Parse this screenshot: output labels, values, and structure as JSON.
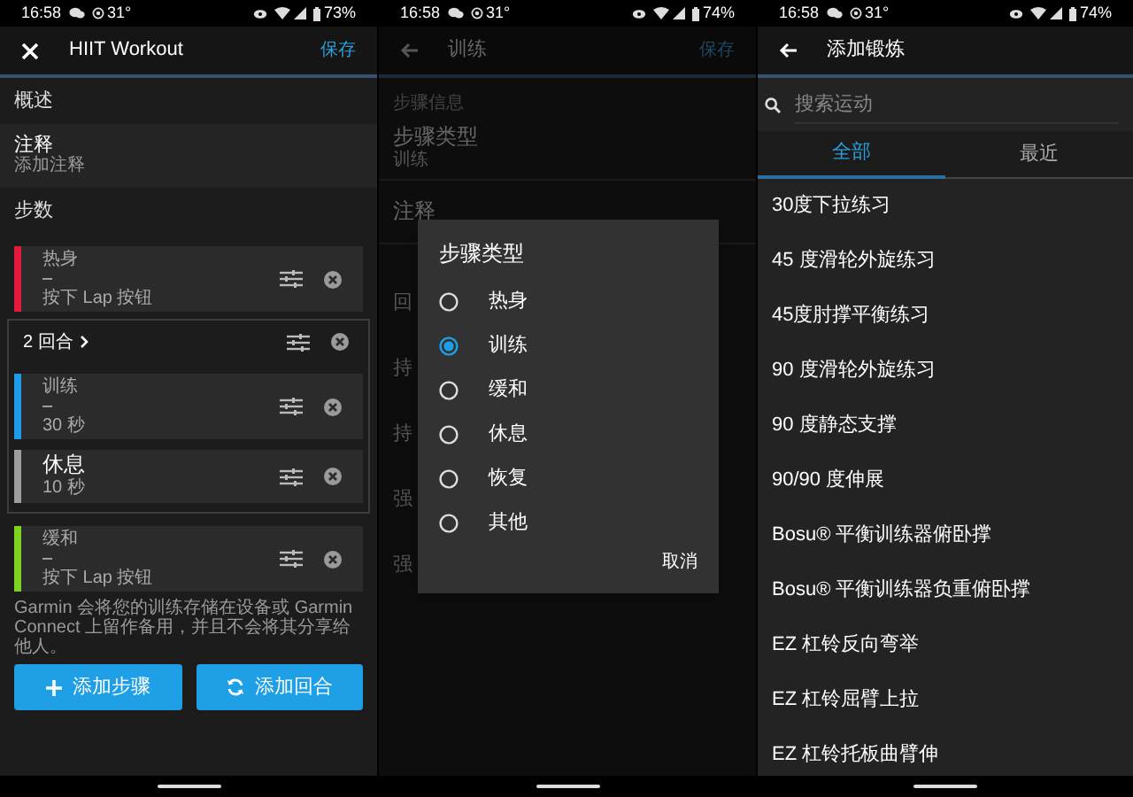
{
  "workout_screen": {
    "status_bar": {
      "time": "16:58",
      "temperature": "31°",
      "battery": "73%"
    },
    "title": "HIIT Workout",
    "save": "保存",
    "overview_header": "概述",
    "note": {
      "label": "注释",
      "placeholder": "添加注释"
    },
    "steps_header": "步数",
    "steps": [
      {
        "kind": "step",
        "color": "#e3183d",
        "title": "热身",
        "target": "–",
        "duration": "按下 Lap 按钮"
      },
      {
        "kind": "repeat",
        "label": "2 回合",
        "children": [
          {
            "kind": "step",
            "color": "#1e9be9",
            "title": "训练",
            "target": "–",
            "duration": "30 秒"
          },
          {
            "kind": "rest",
            "color": "#9e9e9e",
            "title": "休息",
            "duration": "10 秒"
          }
        ]
      },
      {
        "kind": "step",
        "color": "#7ed321",
        "title": "缓和",
        "target": "–",
        "duration": "按下 Lap 按钮"
      }
    ],
    "footnote": "Garmin 会将您的训练存储在设备或 Garmin Connect 上留作备用，并且不会将其分享给他人。",
    "buttons": [
      {
        "kind": "add",
        "label": "添加步骤"
      },
      {
        "kind": "repeat",
        "label": "添加回合"
      }
    ]
  },
  "step_screen": {
    "status_bar": {
      "time": "16:58",
      "temperature": "31°",
      "battery": "74%"
    },
    "title": "训练",
    "save": "保存",
    "section": "步骤信息",
    "fields": [
      {
        "label": "步骤类型",
        "value": "训练"
      },
      {
        "label": "注释"
      }
    ],
    "partial_labels": [
      "回",
      "持",
      "持",
      "强",
      "强"
    ],
    "dialog": {
      "title": "步骤类型",
      "options": [
        {
          "label": "热身",
          "selected": false
        },
        {
          "label": "训练",
          "selected": true
        },
        {
          "label": "缓和",
          "selected": false
        },
        {
          "label": "休息",
          "selected": false
        },
        {
          "label": "恢复",
          "selected": false
        },
        {
          "label": "其他",
          "selected": false
        }
      ],
      "cancel": "取消"
    }
  },
  "exercise_screen": {
    "status_bar": {
      "time": "16:58",
      "temperature": "31°",
      "battery": "74%"
    },
    "title": "添加锻炼",
    "search": {
      "placeholder": "搜索运动"
    },
    "tabs": [
      {
        "label": "全部",
        "selected": true
      },
      {
        "label": "最近",
        "selected": false
      }
    ],
    "items": [
      "30度下拉练习",
      "45 度滑轮外旋练习",
      "45度肘撑平衡练习",
      "90 度滑轮外旋练习",
      "90 度静态支撑",
      "90/90 度伸展",
      "Bosu® 平衡训练器俯卧撑",
      "Bosu® 平衡训练器负重俯卧撑",
      "EZ 杠铃反向弯举",
      "EZ 杠铃屈臂上拉",
      "EZ 杠铃托板曲臂伸"
    ]
  }
}
